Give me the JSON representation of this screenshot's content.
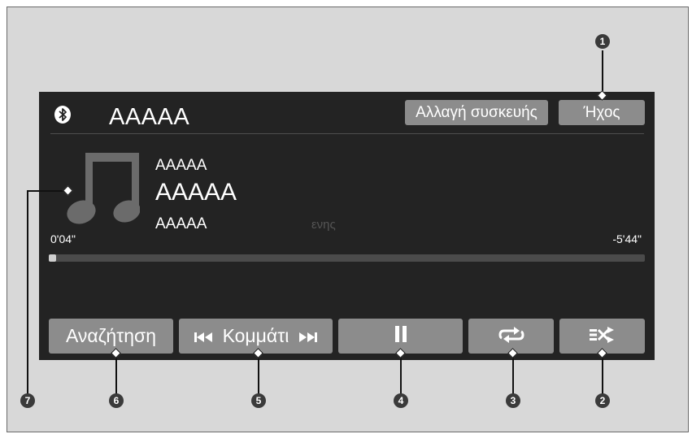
{
  "source": {
    "title": "AAAAA",
    "icon": "bluetooth-icon"
  },
  "top_buttons": {
    "change_device": "Αλλαγή συσκευής",
    "sound": "Ήχος"
  },
  "track": {
    "line1": "AAAAA",
    "line2": "AAAAA",
    "line3": "AAAAA",
    "ghost_text": "ενης"
  },
  "times": {
    "elapsed": "0'04\"",
    "remaining": "-5'44\""
  },
  "progress": {
    "fraction": 0.012
  },
  "bottom_buttons": {
    "search": "Αναζήτηση",
    "track": "Κομμάτι",
    "pause_icon": "pause-icon",
    "repeat_icon": "repeat-icon",
    "shuffle_icon": "shuffle-icon"
  },
  "callouts": [
    "1",
    "2",
    "3",
    "4",
    "5",
    "6",
    "7"
  ],
  "colors": {
    "screen_bg": "#232323",
    "button_bg": "#8c8c8c",
    "progress_fill": "#cfcfcf"
  }
}
